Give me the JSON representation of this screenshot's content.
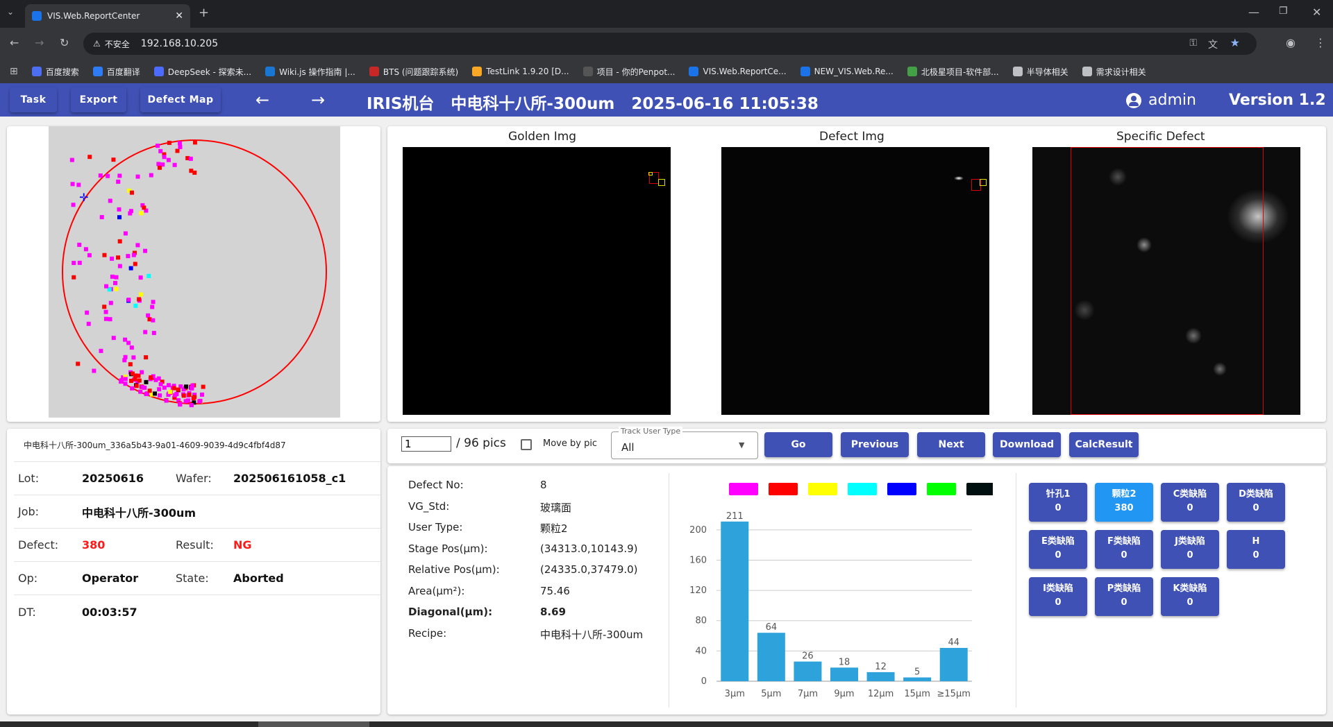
{
  "browser": {
    "tab_title": "VIS.Web.ReportCenter",
    "not_secure": "不安全",
    "url": "192.168.10.205",
    "bookmarks": [
      "百度搜索",
      "百度翻译",
      "DeepSeek - 探索未...",
      "Wiki.js 操作指南 |...",
      "BTS (问题跟踪系统)",
      "TestLink 1.9.20 [D...",
      "项目 - 你的Penpot...",
      "VIS.Web.ReportCe...",
      "NEW_VIS.Web.Re...",
      "北极星项目-软件部...",
      "半导体相关",
      "需求设计相关"
    ],
    "bookmark_colors": [
      "#4e6ef2",
      "#2d7cf6",
      "#4d6bfe",
      "#1976d2",
      "#c62828",
      "#f9a825",
      "#555555",
      "#1a73e8",
      "#1a73e8",
      "#43a047",
      "#bdc1c6",
      "#bdc1c6"
    ]
  },
  "toolbar": {
    "task": "Task",
    "export": "Export",
    "defect_map": "Defect Map",
    "title": "IRIS机台   中电科十八所-300um   2025-06-16 11:05:38",
    "user": "admin",
    "version": "Version 1.2"
  },
  "wafer_map": {
    "colors": [
      "#ff00ff",
      "#ff0000",
      "#ffff00",
      "#00ffff",
      "#0000ff",
      "#000000"
    ]
  },
  "images": {
    "golden_label": "Golden Img",
    "defect_label": "Defect Img",
    "specific_label": "Specific Defect"
  },
  "info": {
    "id_line": "中电科十八所-300um_336a5b43-9a01-4609-9039-4d9c4fbf4d87",
    "lot_label": "Lot:",
    "lot": "20250616",
    "wafer_label": "Wafer:",
    "wafer": "202506161058_c1",
    "job_label": "Job:",
    "job": "中电科十八所-300um",
    "defect_label": "Defect:",
    "defect": "380",
    "result_label": "Result:",
    "result": "NG",
    "op_label": "Op:",
    "op": "Operator",
    "state_label": "State:",
    "state": "Aborted",
    "dt_label": "DT:",
    "dt": "00:03:57"
  },
  "controls": {
    "page_value": "1",
    "total": "/ 96 pics",
    "move_by_pic": "Move by pic",
    "track_label": "Track User Type",
    "track_value": "All",
    "go": "Go",
    "previous": "Previous",
    "next": "Next",
    "download": "Download",
    "calc": "CalcResult"
  },
  "defect_detail": {
    "labels": [
      "Defect No:",
      "VG_Std:",
      "User Type:",
      "Stage Pos(μm):",
      "Relative Pos(μm):",
      "Area(μm²):",
      "Diagonal(μm):",
      "Recipe:"
    ],
    "values": [
      "8",
      "玻璃面",
      "颗粒2",
      "(34313.0,10143.9)",
      "(24335.0,37479.0)",
      "75.46",
      "8.69",
      "中电科十八所-300um"
    ]
  },
  "legend_colors": [
    "#ff00ff",
    "#ff0000",
    "#ffff00",
    "#00ffff",
    "#0000ff",
    "#00ff00",
    "#000f0f"
  ],
  "chart_data": {
    "type": "bar",
    "categories": [
      "3μm",
      "5μm",
      "7μm",
      "9μm",
      "12μm",
      "15μm",
      "≥15μm"
    ],
    "values": [
      211,
      64,
      26,
      18,
      12,
      5,
      44
    ],
    "yticks": [
      0,
      40,
      80,
      120,
      160,
      200
    ],
    "ylim": [
      0,
      220
    ],
    "bar_color": "#2ea3db"
  },
  "classes": [
    {
      "name": "针孔1",
      "count": "0"
    },
    {
      "name": "颗粒2",
      "count": "380"
    },
    {
      "name": "C类缺陷",
      "count": "0"
    },
    {
      "name": "D类缺陷",
      "count": "0"
    },
    {
      "name": "E类缺陷",
      "count": "0"
    },
    {
      "name": "F类缺陷",
      "count": "0"
    },
    {
      "name": "J类缺陷",
      "count": "0"
    },
    {
      "name": "H",
      "count": "0"
    },
    {
      "name": "I类缺陷",
      "count": "0"
    },
    {
      "name": "P类缺陷",
      "count": "0"
    },
    {
      "name": "K类缺陷",
      "count": "0"
    }
  ]
}
